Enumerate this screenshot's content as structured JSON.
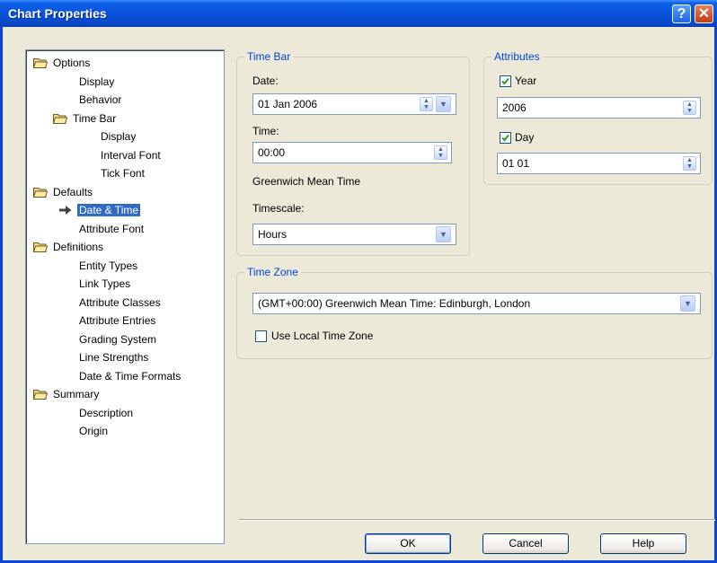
{
  "window": {
    "title": "Chart Properties",
    "help_label": "?",
    "close_label": "✕"
  },
  "tree": [
    {
      "label": "Options",
      "folder": true
    },
    {
      "label": "Display"
    },
    {
      "label": "Behavior"
    },
    {
      "label": "Time Bar",
      "folder": true
    },
    {
      "label": "Display"
    },
    {
      "label": "Interval Font"
    },
    {
      "label": "Tick Font"
    },
    {
      "label": "Defaults",
      "folder": true
    },
    {
      "label": "Date & Time",
      "selected": true
    },
    {
      "label": "Attribute Font"
    },
    {
      "label": "Definitions",
      "folder": true
    },
    {
      "label": "Entity Types"
    },
    {
      "label": "Link Types"
    },
    {
      "label": "Attribute Classes"
    },
    {
      "label": "Attribute Entries"
    },
    {
      "label": "Grading System"
    },
    {
      "label": "Line Strengths"
    },
    {
      "label": "Date & Time Formats"
    },
    {
      "label": "Summary",
      "folder": true
    },
    {
      "label": "Description"
    },
    {
      "label": "Origin"
    }
  ],
  "time_bar": {
    "title": "Time Bar",
    "date_label": "Date:",
    "date_value": "01 Jan 2006",
    "time_label": "Time:",
    "time_value": "00:00",
    "timezone_text": "Greenwich Mean Time",
    "timescale_label": "Timescale:",
    "timescale_value": "Hours"
  },
  "attributes": {
    "title": "Attributes",
    "year_label": "Year",
    "year_checked": true,
    "year_value": "2006",
    "day_label": "Day",
    "day_checked": true,
    "day_value": "01 01"
  },
  "time_zone": {
    "title": "Time Zone",
    "value": "(GMT+00:00) Greenwich Mean Time: Edinburgh, London",
    "use_local_label": "Use Local Time Zone",
    "use_local_checked": false
  },
  "buttons": {
    "ok": "OK",
    "cancel": "Cancel",
    "help": "Help"
  }
}
